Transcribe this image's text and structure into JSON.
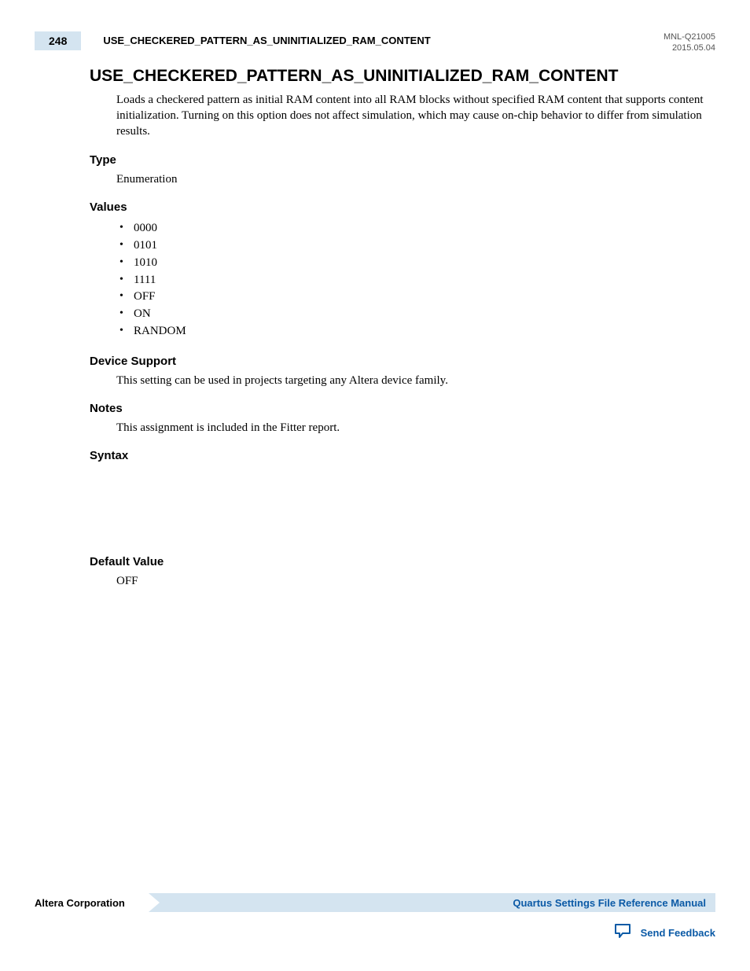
{
  "header": {
    "page_number": "248",
    "running_title": "USE_CHECKERED_PATTERN_AS_UNINITIALIZED_RAM_CONTENT",
    "doc_id": "MNL-Q21005",
    "date": "2015.05.04"
  },
  "main": {
    "heading": "USE_CHECKERED_PATTERN_AS_UNINITIALIZED_RAM_CONTENT",
    "description": "Loads a checkered pattern as initial RAM content into all RAM blocks without specified RAM content that supports content initialization. Turning on this option does not affect simulation, which may cause on-chip behavior to differ from simulation results.",
    "type": {
      "label": "Type",
      "value": "Enumeration"
    },
    "values": {
      "label": "Values",
      "items": [
        "0000",
        "0101",
        "1010",
        "1111",
        "OFF",
        "ON",
        "RANDOM"
      ]
    },
    "device_support": {
      "label": "Device Support",
      "value": "This setting can be used in projects targeting any Altera device family."
    },
    "notes": {
      "label": "Notes",
      "value": "This assignment is included in the Fitter report."
    },
    "syntax": {
      "label": "Syntax"
    },
    "default_value": {
      "label": "Default Value",
      "value": "OFF"
    }
  },
  "footer": {
    "company": "Altera Corporation",
    "manual_link": "Quartus Settings File Reference Manual",
    "feedback": "Send Feedback"
  }
}
